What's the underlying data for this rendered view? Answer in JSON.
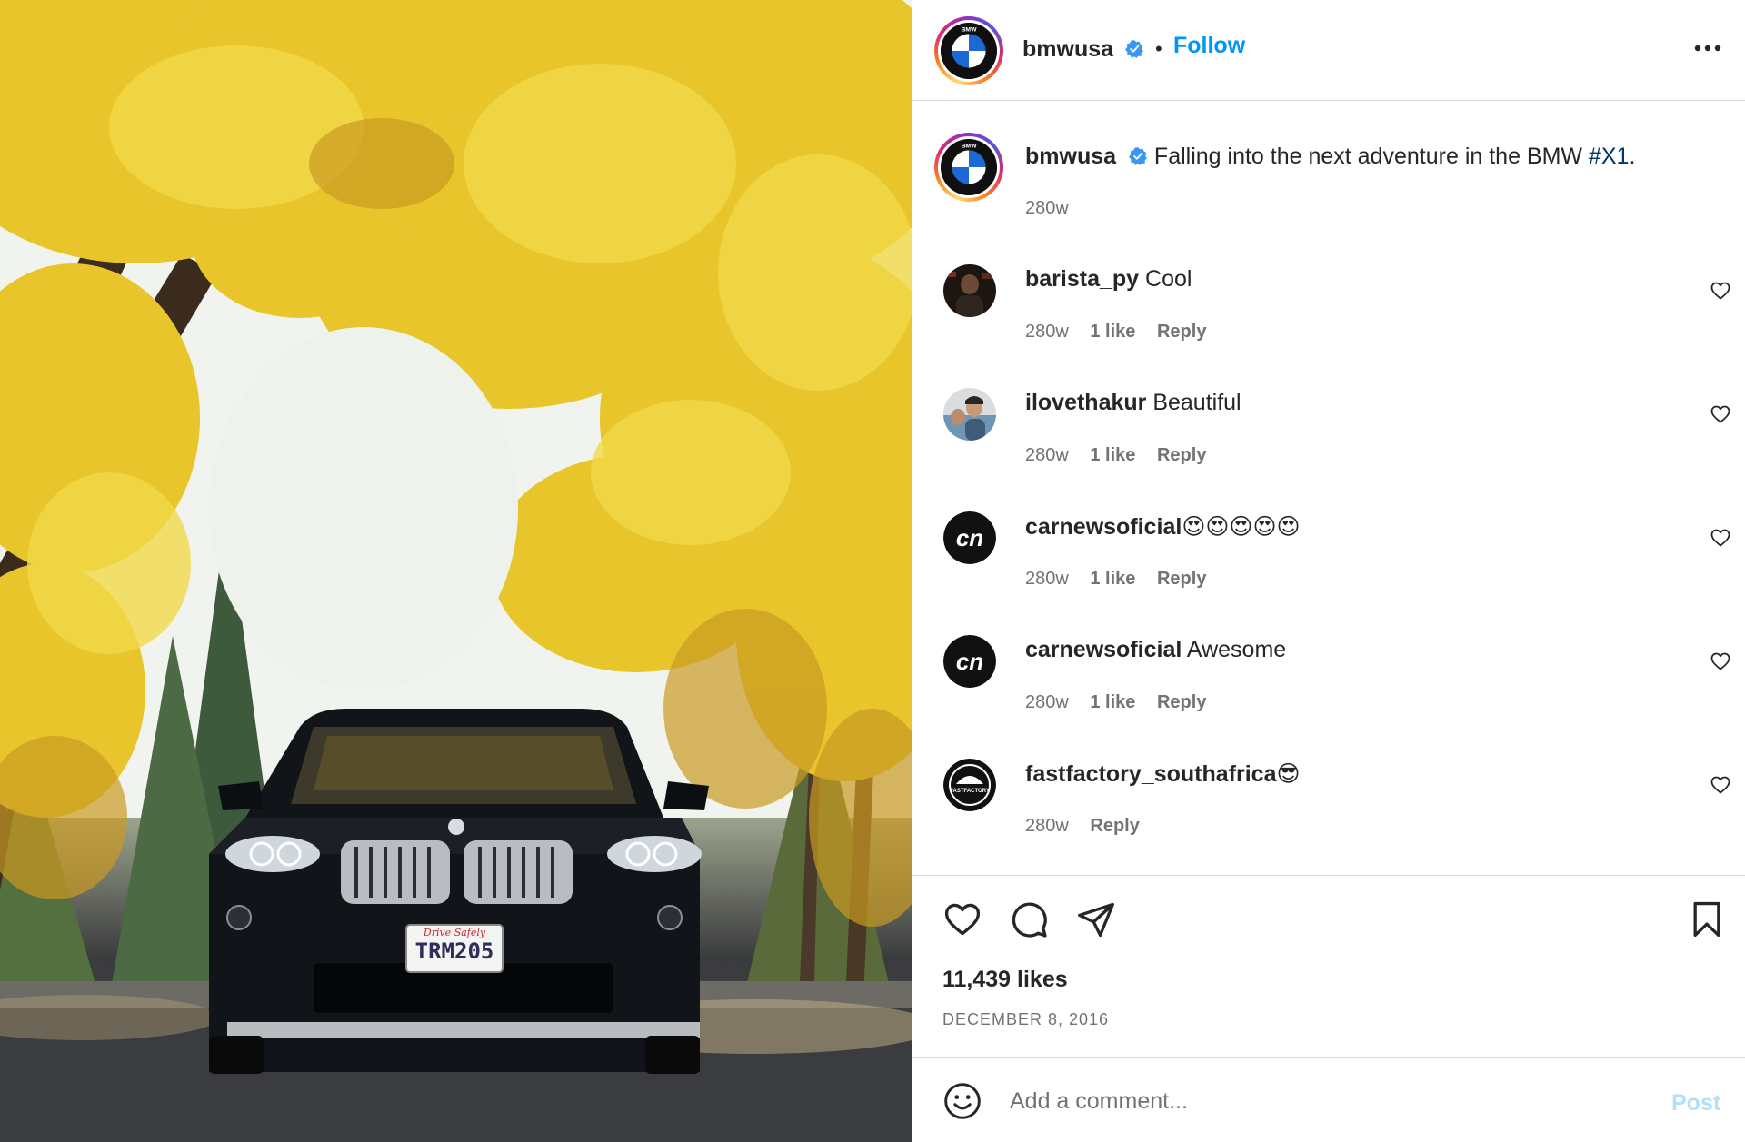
{
  "post": {
    "username": "bmwusa",
    "follow_label": "Follow",
    "separator": "•",
    "caption_text": " Falling into the next adventure in the BMW ",
    "caption_hashtag": "#X1",
    "caption_end": ".",
    "caption_time": "280w",
    "likes_text": "11,439 likes",
    "date_text": "DECEMBER 8, 2016",
    "photo": {
      "plate_top": "Drive Safely",
      "plate_number": "TRM205",
      "hood_badge": "BMW"
    }
  },
  "comments": [
    {
      "username": "barista_py",
      "text": " Cool",
      "time": "280w",
      "likes": "1 like",
      "reply": "Reply",
      "avatar_icon": "person-photo-avatar"
    },
    {
      "username": "ilovethakur",
      "text": " Beautiful",
      "time": "280w",
      "likes": "1 like",
      "reply": "Reply",
      "avatar_icon": "person-photo-avatar"
    },
    {
      "username": "carnewsoficial",
      "text": " 😍😍😍😍😍",
      "time": "280w",
      "likes": "1 like",
      "reply": "Reply",
      "avatar_icon": "cn-logo"
    },
    {
      "username": "carnewsoficial",
      "text": " Awesome",
      "time": "280w",
      "likes": "1 like",
      "reply": "Reply",
      "avatar_icon": "cn-logo"
    },
    {
      "username": "fastfactory_southafrica",
      "text": " 😎",
      "time": "280w",
      "likes": "",
      "reply": "Reply",
      "avatar_icon": "fastfactory-logo"
    }
  ],
  "composer": {
    "placeholder": "Add a comment...",
    "post_label": "Post"
  },
  "avatar_logo_letters": "BMW",
  "cn_logo_text": "cn",
  "fastfactory_logo_text": "FASTFACTORY",
  "colors": {
    "follow_blue": "#0095f6",
    "verified_blue": "#3897f0",
    "hashtag_blue": "#00376b",
    "post_disabled": "#b2dffc",
    "muted_text": "#737373"
  }
}
